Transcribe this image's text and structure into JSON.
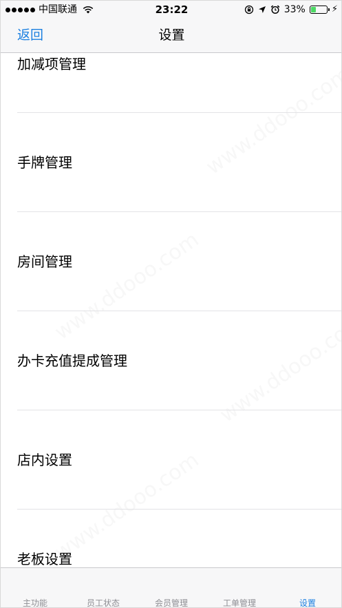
{
  "status_bar": {
    "carrier": "中国联通",
    "time": "23:22",
    "battery_percent": "33%",
    "battery_level": 0.33,
    "battery_color": "#4cd964",
    "icons": [
      "signal-dots-icon",
      "wifi-icon",
      "orientation-lock-icon",
      "location-arrow-icon",
      "alarm-icon",
      "battery-icon",
      "charging-bolt-icon"
    ]
  },
  "nav": {
    "back_label": "返回",
    "title": "设置"
  },
  "list": {
    "items": [
      {
        "label": "加减项管理"
      },
      {
        "label": "手牌管理"
      },
      {
        "label": "房间管理"
      },
      {
        "label": "办卡充值提成管理"
      },
      {
        "label": "店内设置"
      },
      {
        "label": "老板设置"
      }
    ]
  },
  "watermark": "www.ddooo.com",
  "tab_bar": {
    "tabs": [
      {
        "label": "主功能",
        "active": false
      },
      {
        "label": "员工状态",
        "active": false
      },
      {
        "label": "会员管理",
        "active": false
      },
      {
        "label": "工单管理",
        "active": false
      },
      {
        "label": "设置",
        "active": true
      }
    ]
  },
  "colors": {
    "accent": "#1a7fe0",
    "inactive_tab": "#8e8e93",
    "separator": "#e3e3e6"
  }
}
